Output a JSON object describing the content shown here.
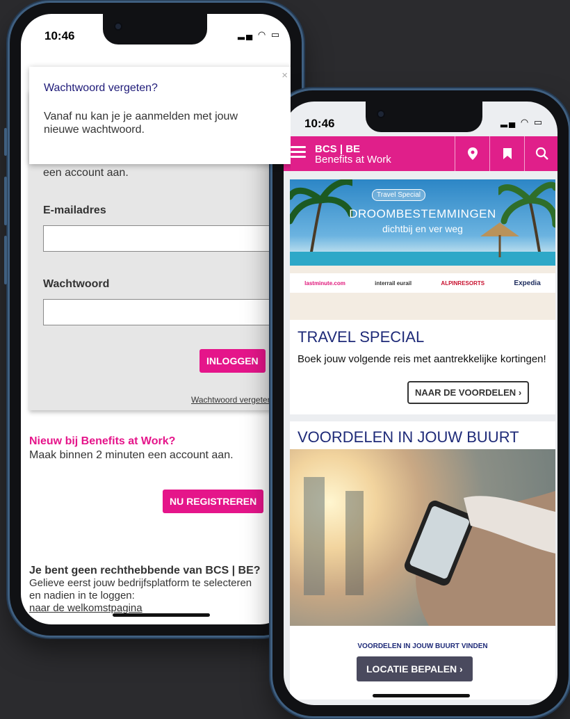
{
  "left_phone": {
    "status_time": "10:46",
    "popup": {
      "title": "Wachtwoord vergeten?",
      "message": "Vanaf nu kan je je aanmelden met jouw nieuwe wachtwoord.",
      "close_glyph": "×"
    },
    "login": {
      "clipped_text": "een account aan.",
      "email_label": "E-mailadres",
      "email_value": "",
      "password_label": "Wachtwoord",
      "password_value": "",
      "login_button": "INLOGGEN",
      "forgot_link": "Wachtwoord vergeten?"
    },
    "register": {
      "heading": "Nieuw bij Benefits at Work?",
      "text": "Maak binnen 2 minuten een account aan.",
      "button": "NU REGISTREREN"
    },
    "not_eligible": {
      "heading": "Je bent geen rechthebbende van BCS | BE?",
      "text1": "Gelieve eerst jouw bedrijfsplatform te selecteren",
      "text2": "en nadien in te loggen:",
      "link": "naar de welkomstpagina"
    }
  },
  "right_phone": {
    "status_time": "10:46",
    "header": {
      "brand_line1": "BCS | BE",
      "brand_line2": "Benefits at Work",
      "icons": [
        "menu-icon",
        "location-pin-icon",
        "bookmark-icon",
        "search-icon"
      ]
    },
    "travel": {
      "banner_badge": "Travel Special",
      "banner_title": "DROOMBESTEMMINGEN",
      "banner_subtitle": "dichtbij en ver weg",
      "partners": [
        "lastminute.com",
        "interrail eurail",
        "ALPINRESORTS",
        "Expedia"
      ],
      "heading": "TRAVEL SPECIAL",
      "text": "Boek jouw volgende reis met aantrekkelijke kortingen!",
      "button": "NAAR DE VOORDELEN"
    },
    "nearby": {
      "heading": "VOORDELEN IN JOUW BUURT",
      "subheading": "VOORDELEN IN JOUW BUURT VINDEN",
      "button": "LOCATIE BEPALEN"
    }
  },
  "colors": {
    "brand_pink": "#e5158a",
    "navy": "#1e2a78",
    "dark_button": "#4a4a5e"
  }
}
